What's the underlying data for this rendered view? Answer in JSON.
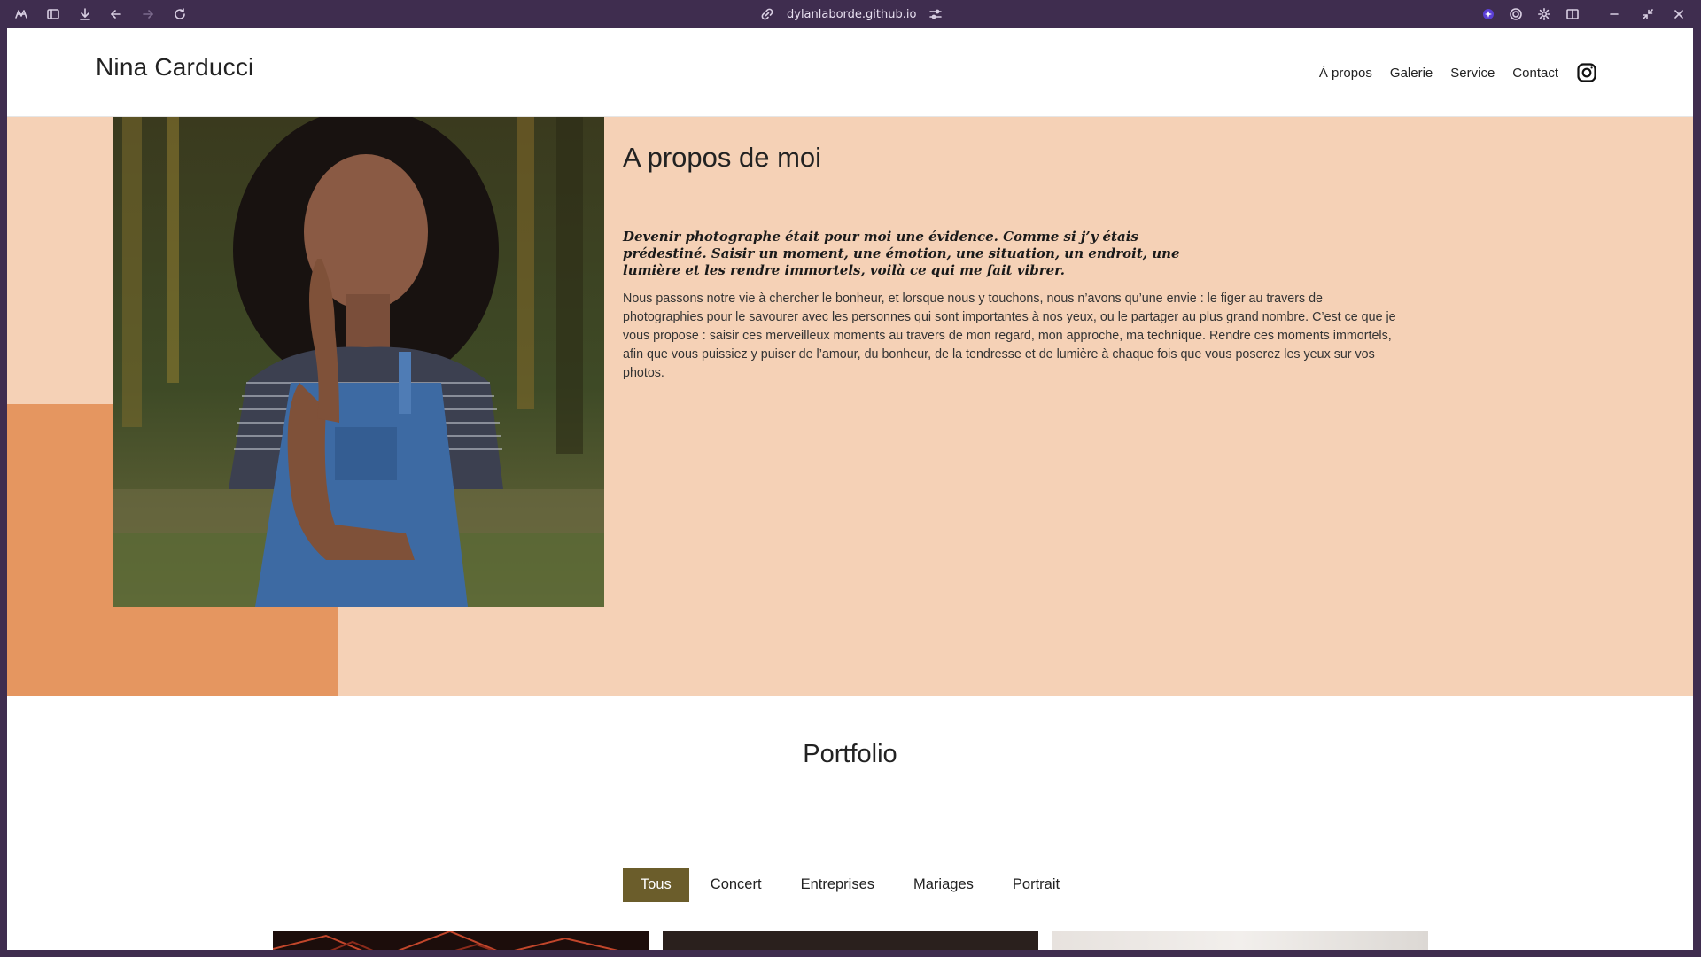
{
  "browser": {
    "url": "dylanlaborde.github.io"
  },
  "header": {
    "title": "Nina Carducci",
    "nav": [
      {
        "label": "À propos"
      },
      {
        "label": "Galerie"
      },
      {
        "label": "Service"
      },
      {
        "label": "Contact"
      }
    ]
  },
  "about": {
    "title": "A propos de moi",
    "quote": "Devenir photographe était pour moi une évidence. Comme si j’y étais prédestiné. Saisir un moment, une émotion, une situation, un endroit, une lumière et les rendre immortels, voilà ce qui me fait vibrer.",
    "body": "Nous passons notre vie à chercher le bonheur, et lorsque nous y touchons, nous n’avons qu’une envie : le figer au travers de photographies pour le savourer avec les personnes qui sont importantes à nos yeux, ou le partager au plus grand nombre. C’est ce que je vous propose : saisir ces merveilleux moments au travers de mon regard, mon approche, ma technique. Rendre ces moments immortels, afin que vous puissiez y puiser de l’amour, du bonheur, de la tendresse et de lumière à chaque fois que vous poserez les yeux sur vos photos."
  },
  "portfolio": {
    "title": "Portfolio",
    "filters": [
      {
        "label": "Tous",
        "active": true
      },
      {
        "label": "Concert"
      },
      {
        "label": "Entreprises"
      },
      {
        "label": "Mariages"
      },
      {
        "label": "Portrait"
      }
    ]
  },
  "colors": {
    "about_bg": "#f5d1b6",
    "about_accent": "#e59660",
    "filter_active": "#6b5d2b",
    "browser_chrome": "#3f2d4f"
  }
}
